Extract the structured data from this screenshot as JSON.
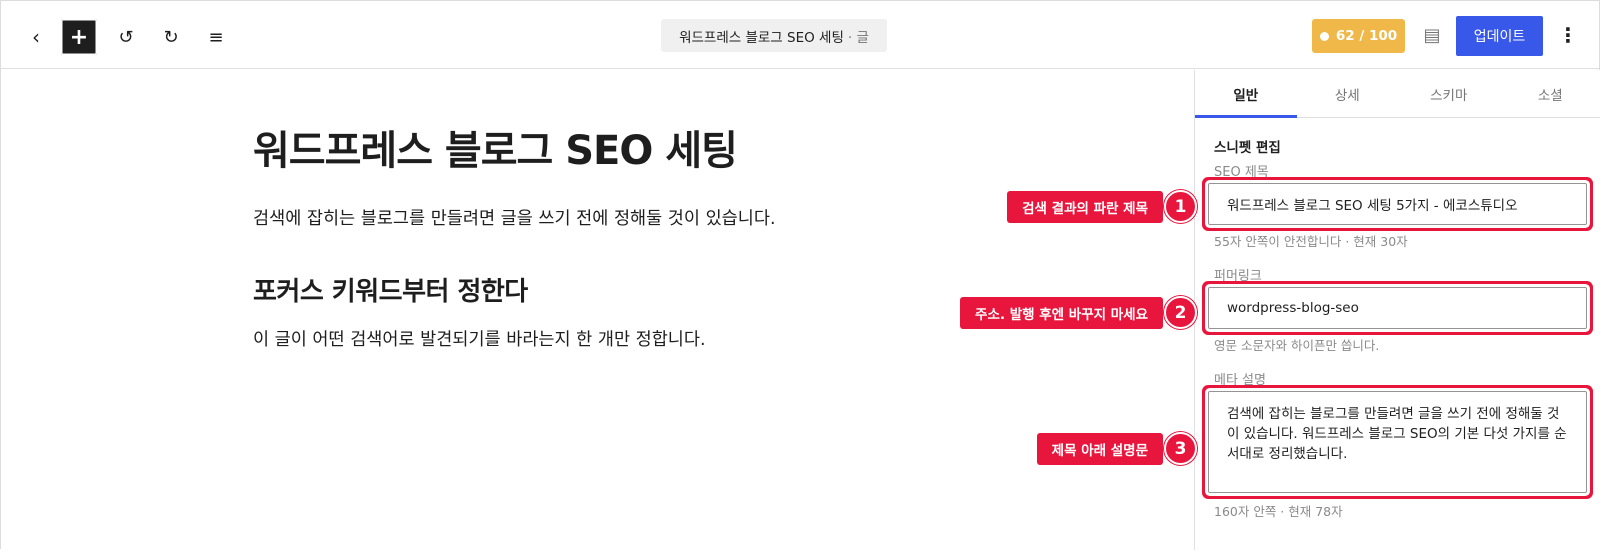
{
  "toolbar": {
    "back_icon": "‹",
    "add_icon": "+",
    "undo_icon": "↺",
    "redo_icon": "↻",
    "list_icon": "≡",
    "doc_title": "워드프레스 블로그 SEO 세팅",
    "doc_type": "· 글",
    "score": "62 / 100",
    "panel_icon": "▤",
    "update_label": "업데이트",
    "more_icon": "⋮",
    "colors": {
      "accent": "#3858e9",
      "score": "#f0b849",
      "callout": "#e8153c"
    }
  },
  "editor": {
    "title": "워드프레스 블로그 SEO 세팅",
    "paragraph1": "검색에 잡히는 블로그를 만들려면 글을 쓰기 전에 정해둘 것이 있습니다.",
    "heading2": "포커스 키워드부터 정한다",
    "paragraph2": "이 글이 어떤 검색어로 발견되기를 바라는지 한 개만 정합니다."
  },
  "sidebar": {
    "tabs": [
      {
        "label": "일반",
        "active": true
      },
      {
        "label": "상세",
        "active": false
      },
      {
        "label": "스키마",
        "active": false
      },
      {
        "label": "소셜",
        "active": false
      }
    ],
    "section_title": "스니펫 편집",
    "seo_title": {
      "label": "SEO 제목",
      "value": "워드프레스 블로그 SEO 세팅 5가지 - 에코스튜디오",
      "help": "55자 안쪽이 안전합니다 · 현재 30자"
    },
    "permalink": {
      "label": "퍼머링크",
      "value": "wordpress-blog-seo",
      "help": "영문 소문자와 하이픈만 씁니다."
    },
    "meta_description": {
      "label": "메타 설명",
      "value": "검색에 잡히는 블로그를 만들려면 글을 쓰기 전에 정해둘 것이 있습니다. 워드프레스 블로그 SEO의 기본 다섯 가지를 순서대로 정리했습니다.",
      "help": "160자 안쪽 · 현재 78자"
    }
  },
  "callouts": [
    {
      "number": "1",
      "label": "검색 결과의 파란 제목"
    },
    {
      "number": "2",
      "label": "주소. 발행 후엔 바꾸지 마세요"
    },
    {
      "number": "3",
      "label": "제목 아래 설명문"
    }
  ]
}
